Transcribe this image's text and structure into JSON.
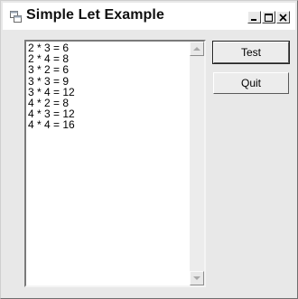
{
  "window": {
    "title": "Simple Let Example",
    "controls": [
      "minimize-icon",
      "maximize-icon",
      "close-icon"
    ]
  },
  "listbox": {
    "items": [
      "2 * 3 = 6",
      "2 * 4 = 8",
      "3 * 2 = 6",
      "3 * 3 = 9",
      "3 * 4 = 12",
      "4 * 2 = 8",
      "4 * 3 = 12",
      "4 * 4 = 16"
    ]
  },
  "buttons": {
    "test_label": "Test",
    "quit_label": "Quit"
  }
}
